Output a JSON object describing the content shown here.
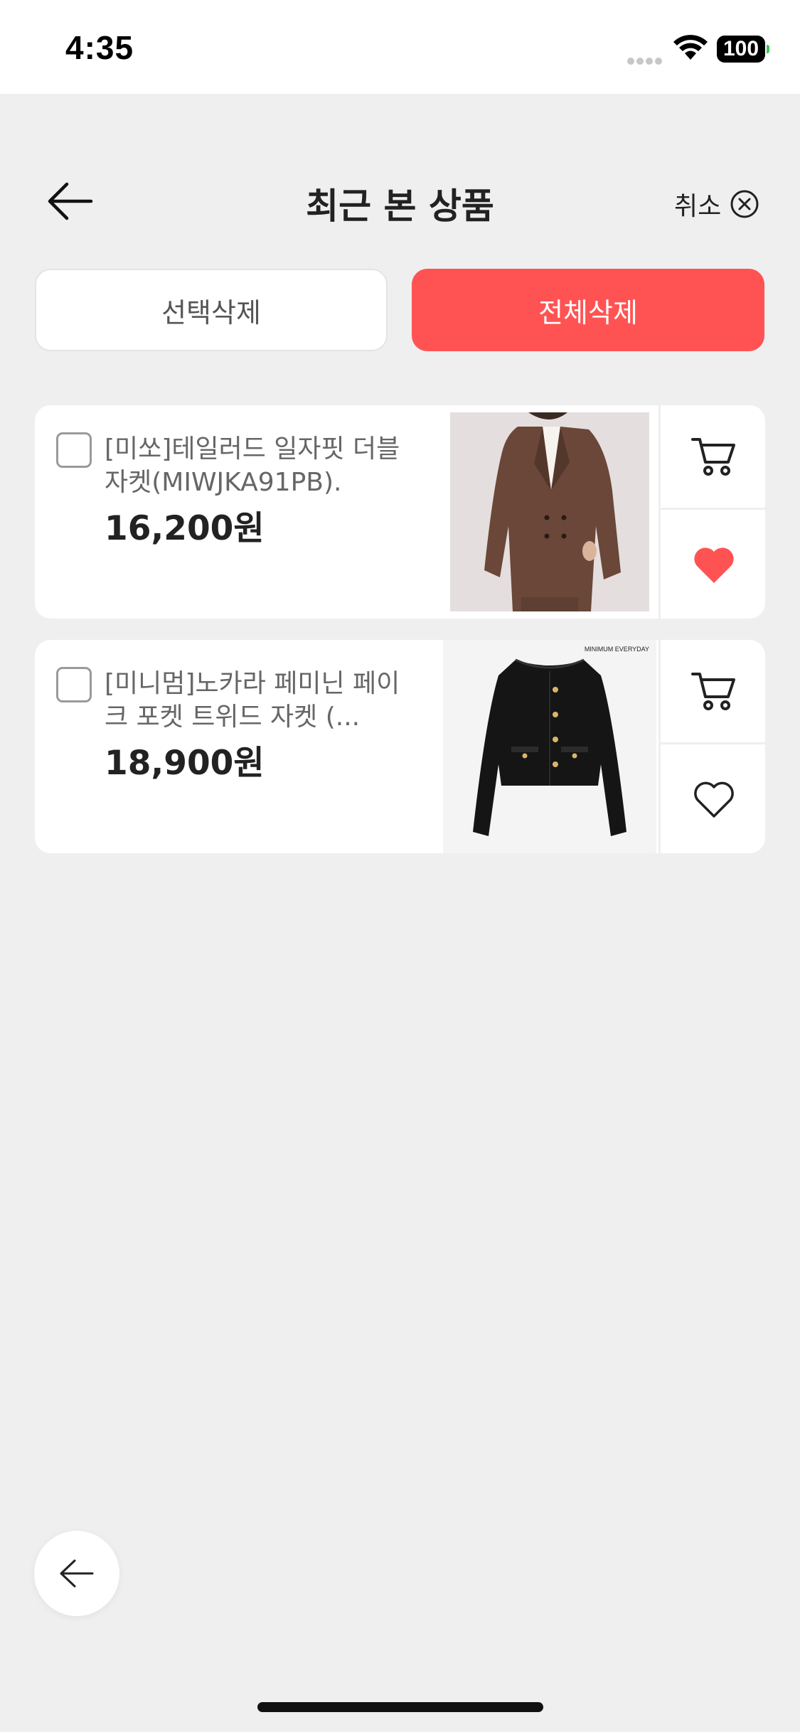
{
  "status_bar": {
    "time": "4:35",
    "battery": "100"
  },
  "header": {
    "title": "최근 본 상품",
    "cancel_label": "취소"
  },
  "actions": {
    "select_delete": "선택삭제",
    "delete_all": "전체삭제"
  },
  "products": [
    {
      "name": "[미쏘]테일러드 일자핏 더블 자켓(MIWJKA91PB).",
      "price": "16,200원",
      "liked": true
    },
    {
      "name": "[미니멈]노카라 페미닌 페이크 포켓 트위드 자켓 (...",
      "price": "18,900원",
      "liked": false,
      "image_brand_text": "MINIMUM EVERYDAY"
    }
  ],
  "colors": {
    "accent": "#ff5353",
    "background": "#efefef",
    "heart_filled": "#ff5353"
  }
}
